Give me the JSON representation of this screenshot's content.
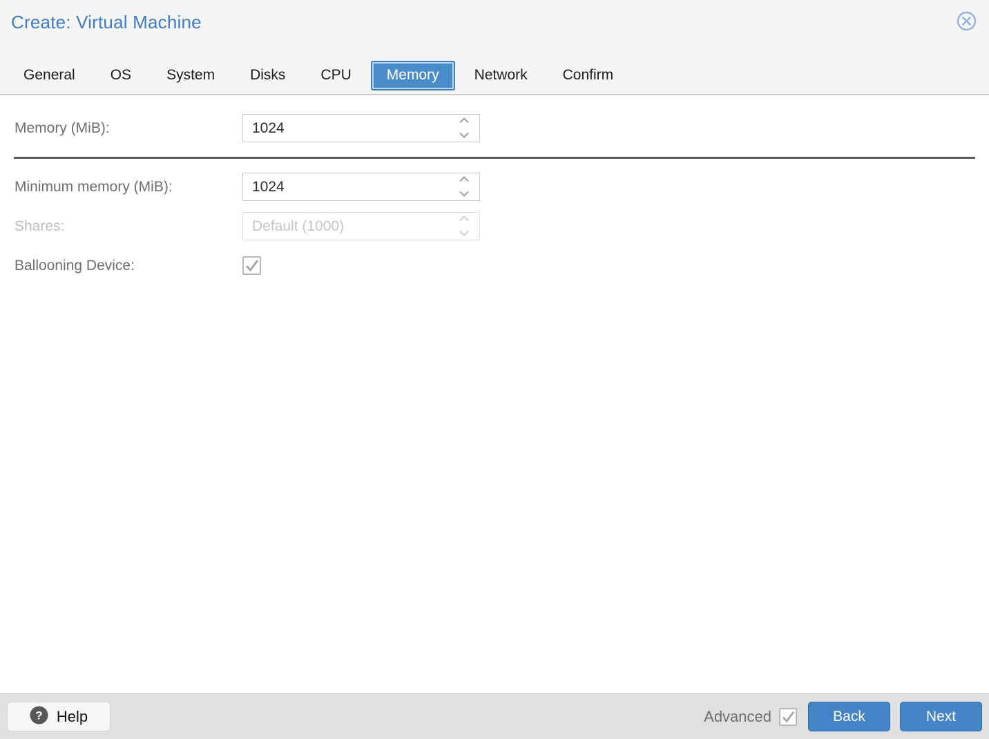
{
  "dialog": {
    "title": "Create: Virtual Machine"
  },
  "tabs": [
    {
      "label": "General",
      "active": false
    },
    {
      "label": "OS",
      "active": false
    },
    {
      "label": "System",
      "active": false
    },
    {
      "label": "Disks",
      "active": false
    },
    {
      "label": "CPU",
      "active": false
    },
    {
      "label": "Memory",
      "active": true
    },
    {
      "label": "Network",
      "active": false
    },
    {
      "label": "Confirm",
      "active": false
    }
  ],
  "form": {
    "memory": {
      "label": "Memory (MiB):",
      "value": "1024"
    },
    "min_memory": {
      "label": "Minimum memory (MiB):",
      "value": "1024"
    },
    "shares": {
      "label": "Shares:",
      "placeholder": "Default (1000)",
      "disabled": true
    },
    "ballooning": {
      "label": "Ballooning Device:",
      "checked": true
    }
  },
  "footer": {
    "help_label": "Help",
    "advanced_label": "Advanced",
    "advanced_checked": true,
    "back_label": "Back",
    "next_label": "Next"
  },
  "icons": {
    "close": "circle-x-icon",
    "help": "question-circle-icon",
    "spinner_up": "chevron-up-icon",
    "spinner_down": "chevron-down-icon",
    "check": "check-icon"
  },
  "colors": {
    "accent_blue": "#4584c6",
    "active_tab_blue": "#4a8cca",
    "title_blue": "#3f7cc0",
    "header_bg": "#f5f5f5",
    "footer_bg": "#e0e0e0",
    "separator_dark": "#5e5e5e"
  }
}
